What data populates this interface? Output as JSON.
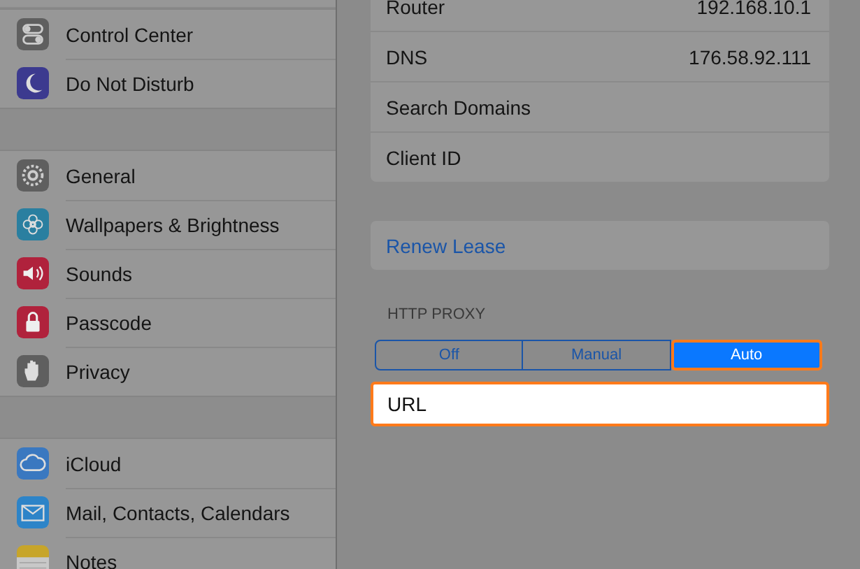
{
  "sidebar": {
    "groups": [
      {
        "items": [
          {
            "label": "Control Center",
            "color": "#5f5f5f"
          },
          {
            "label": "Do Not Disturb",
            "color": "#3c3a8f"
          }
        ]
      },
      {
        "items": [
          {
            "label": "General",
            "color": "#5f5f5f"
          },
          {
            "label": "Wallpapers & Brightness",
            "color": "#2a7fa0"
          },
          {
            "label": "Sounds",
            "color": "#b0223c"
          },
          {
            "label": "Passcode",
            "color": "#b0223c"
          },
          {
            "label": "Privacy",
            "color": "#5f5f5f"
          }
        ]
      },
      {
        "items": [
          {
            "label": "iCloud",
            "color": "#3a78c0"
          },
          {
            "label": "Mail, Contacts, Calendars",
            "color": "#2d84c8"
          },
          {
            "label": "Notes",
            "color": "#c7a52a"
          }
        ]
      }
    ]
  },
  "details": {
    "rows": [
      {
        "label": "Router",
        "value": "192.168.10.1"
      },
      {
        "label": "DNS",
        "value": "176.58.92.111"
      },
      {
        "label": "Search Domains"
      },
      {
        "label": "Client ID"
      }
    ]
  },
  "renew_lease": "Renew Lease",
  "http_proxy": {
    "title": "HTTP PROXY",
    "options": [
      {
        "label": "Off",
        "selected": false,
        "highlighted": false
      },
      {
        "label": "Manual",
        "selected": false,
        "highlighted": false
      },
      {
        "label": "Auto",
        "selected": true,
        "highlighted": true
      }
    ],
    "url_field": {
      "label": "URL",
      "highlighted": true
    }
  }
}
